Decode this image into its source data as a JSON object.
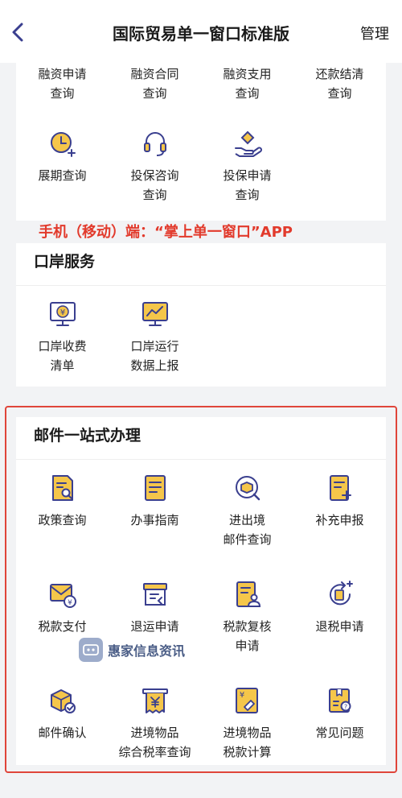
{
  "header": {
    "title": "国际贸易单一窗口标准版",
    "manage_label": "管理"
  },
  "finance": {
    "row1": [
      "融资申请\n查询",
      "融资合同\n查询",
      "融资支用\n查询",
      "还款结清\n查询"
    ],
    "row2": [
      "展期查询",
      "投保咨询\n查询",
      "投保申请\n查询"
    ]
  },
  "promo_text": "手机（移动）端：“掌上单一窗口”APP",
  "port": {
    "title": "口岸服务",
    "items": [
      "口岸收费\n清单",
      "口岸运行\n数据上报"
    ]
  },
  "mail": {
    "title": "邮件一站式办理",
    "items": [
      "政策查询",
      "办事指南",
      "进出境\n邮件查询",
      "补充申报",
      "税款支付",
      "退运申请",
      "税款复核\n申请",
      "退税申请",
      "邮件确认",
      "进境物品\n综合税率查询",
      "进境物品\n税款计算",
      "常见问题"
    ]
  },
  "watermark": {
    "text": "惠家信息资讯"
  },
  "colors": {
    "accent": "#3a3f8f",
    "icon_fill": "#f5c64a",
    "highlight": "#e23a2c"
  }
}
